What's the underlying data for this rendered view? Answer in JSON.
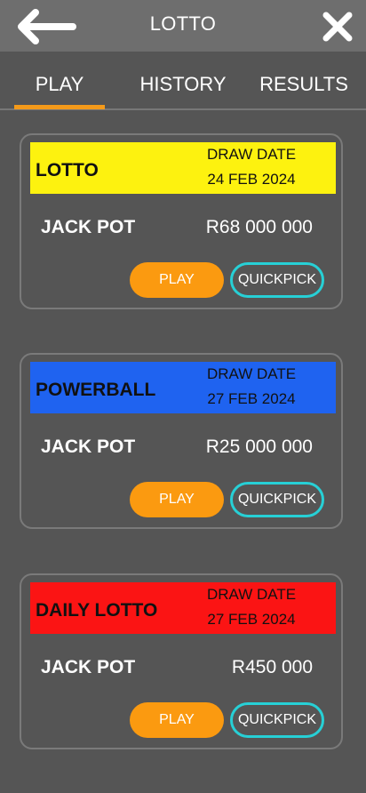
{
  "header": {
    "title": "LOTTO",
    "back_icon": "arrow-left-icon",
    "close_icon": "close-icon"
  },
  "tabs": [
    {
      "label": "PLAY",
      "active": true
    },
    {
      "label": "HISTORY",
      "active": false
    },
    {
      "label": "RESULTS",
      "active": false
    }
  ],
  "colors": {
    "background": "#555555",
    "topbar": "#6e6e6e",
    "accent_orange": "#fb9a10",
    "quickpick_border": "#27d0d6",
    "lotto_banner": "#fdf20f",
    "powerball_banner": "#1f63f0",
    "daily_lotto_banner": "#fb1414"
  },
  "games": [
    {
      "name": "LOTTO",
      "draw_date_label": "DRAW DATE",
      "draw_date": "24 FEB 2024",
      "jackpot_label": "JACK POT",
      "jackpot": "R68 000 000",
      "play_label": "PLAY",
      "quickpick_label": "QUICKPICK"
    },
    {
      "name": "POWERBALL",
      "draw_date_label": "DRAW DATE",
      "draw_date": "27 FEB 2024",
      "jackpot_label": "JACK POT",
      "jackpot": "R25 000 000",
      "play_label": "PLAY",
      "quickpick_label": "QUICKPICK"
    },
    {
      "name": "DAILY LOTTO",
      "draw_date_label": "DRAW DATE",
      "draw_date": "27 FEB 2024",
      "jackpot_label": "JACK POT",
      "jackpot": "R450 000",
      "play_label": "PLAY",
      "quickpick_label": "QUICKPICK"
    }
  ]
}
